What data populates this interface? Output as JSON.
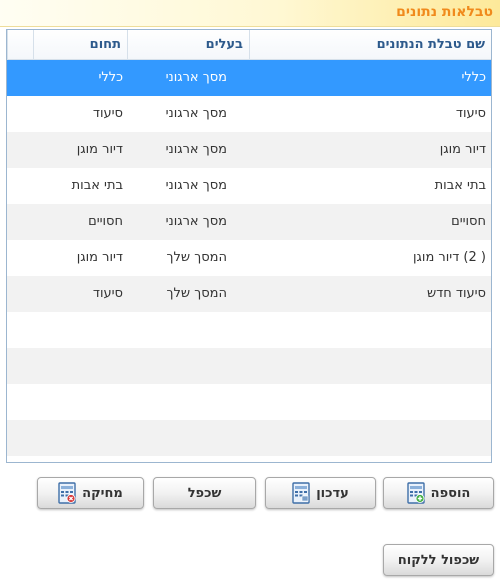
{
  "panel": {
    "title": "טבלאות נתונים"
  },
  "table": {
    "columns": {
      "name": "שם טבלת הנתונים",
      "owner": "בעלים",
      "domain": "תחום"
    },
    "rows": [
      {
        "name": "כללי",
        "owner": "מסך ארגוני",
        "domain": "כללי",
        "selected": true
      },
      {
        "name": "סיעוד",
        "owner": "מסך ארגוני",
        "domain": "סיעוד"
      },
      {
        "name": "דיור מוגן",
        "owner": "מסך ארגוני",
        "domain": "דיור מוגן"
      },
      {
        "name": "בתי אבות",
        "owner": "מסך ארגוני",
        "domain": "בתי אבות"
      },
      {
        "name": "חסויים",
        "owner": "מסך ארגוני",
        "domain": "חסויים"
      },
      {
        "name": "( 2) דיור מוגן",
        "owner": "המסך שלך",
        "domain": "דיור מוגן"
      },
      {
        "name": "סיעוד חדש",
        "owner": "המסך שלך",
        "domain": "סיעוד"
      }
    ]
  },
  "buttons": {
    "add": "הוספה",
    "update": "עדכון",
    "duplicate": "שכפל",
    "delete": "מחיקה",
    "duplicate_to_customer": "שכפול ללקוח"
  },
  "colors": {
    "accent": "#f08a1c",
    "selection": "#3399ff",
    "header_text": "#2d5a8c"
  }
}
